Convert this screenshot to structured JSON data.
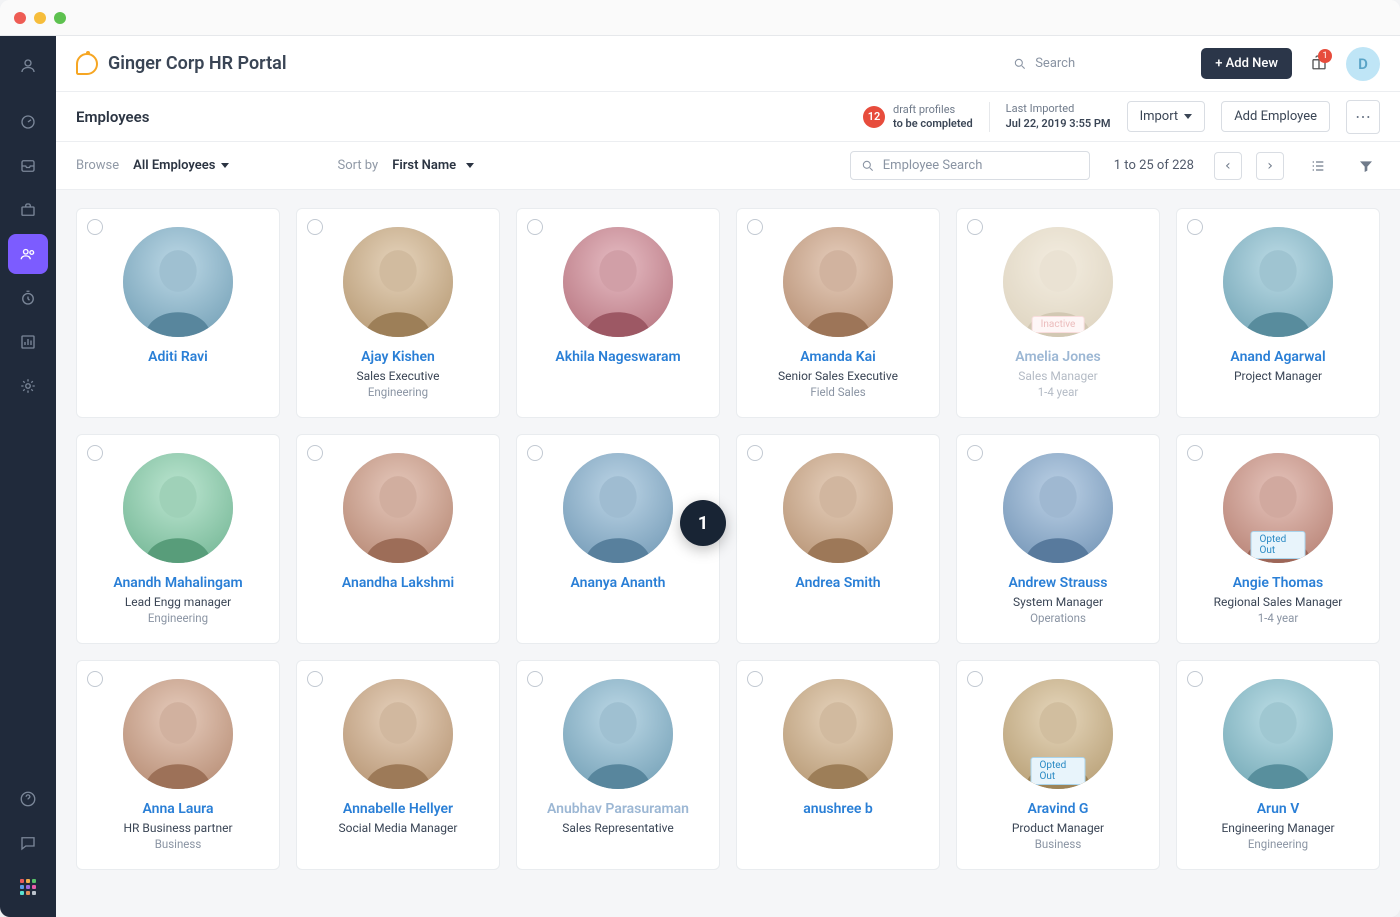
{
  "sidebar": {
    "items": [
      {
        "name": "profile",
        "active": false
      },
      {
        "name": "dashboard",
        "active": false
      },
      {
        "name": "inbox",
        "active": false
      },
      {
        "name": "briefcase",
        "active": false
      },
      {
        "name": "people",
        "active": true
      },
      {
        "name": "time",
        "active": false
      },
      {
        "name": "reports",
        "active": false
      },
      {
        "name": "settings",
        "active": false
      }
    ],
    "bottom": [
      {
        "name": "help"
      },
      {
        "name": "chat"
      },
      {
        "name": "apps"
      }
    ]
  },
  "topbar": {
    "brand": "Ginger Corp HR Portal",
    "search_placeholder": "Search",
    "add_new_label": "+ Add New",
    "gift_badge": "1",
    "avatar_letter": "D"
  },
  "pageheader": {
    "title": "Employees",
    "draft_count": "12",
    "draft_line1": "draft profiles",
    "draft_line2": "to be completed",
    "last_imported_label": "Last Imported",
    "last_imported_value": "Jul 22, 2019 3:55 PM",
    "import_label": "Import",
    "add_employee_label": "Add Employee"
  },
  "filters": {
    "browse_label": "Browse",
    "browse_value": "All Employees",
    "sort_label": "Sort by",
    "sort_value": "First Name",
    "employee_search_placeholder": "Employee Search",
    "pagination_info": "1 to 25 of 228"
  },
  "step_badge": "1",
  "employees": [
    {
      "name": "Aditi Ravi",
      "role": "",
      "dept": "",
      "status": null,
      "muted": false,
      "hue": 200
    },
    {
      "name": "Ajay Kishen",
      "role": "Sales Executive",
      "dept": "Engineering",
      "status": null,
      "muted": false,
      "hue": 34
    },
    {
      "name": "Akhila Nageswaram",
      "role": "",
      "dept": "",
      "status": null,
      "muted": false,
      "hue": 350
    },
    {
      "name": "Amanda Kai",
      "role": "Senior Sales Executive",
      "dept": "Field Sales",
      "status": null,
      "muted": false,
      "hue": 25
    },
    {
      "name": "Amelia Jones",
      "role": "Sales Manager",
      "dept": "1-4 year",
      "status": "Inactive",
      "muted": true,
      "hue": 40
    },
    {
      "name": "Anand Agarwal",
      "role": "Project Manager",
      "dept": "",
      "status": null,
      "muted": false,
      "hue": 195
    },
    {
      "name": "Anandh Mahalingam",
      "role": "Lead Engg manager",
      "dept": "Engineering",
      "status": null,
      "muted": false,
      "hue": 150
    },
    {
      "name": "Anandha Lakshmi",
      "role": "",
      "dept": "",
      "status": null,
      "muted": false,
      "hue": 18
    },
    {
      "name": "Ananya Ananth",
      "role": "",
      "dept": "",
      "status": null,
      "muted": false,
      "hue": 205
    },
    {
      "name": "Andrea Smith",
      "role": "",
      "dept": "",
      "status": null,
      "muted": false,
      "hue": 28
    },
    {
      "name": "Andrew Strauss",
      "role": "System Manager",
      "dept": "Operations",
      "status": null,
      "muted": false,
      "hue": 210
    },
    {
      "name": "Angie Thomas",
      "role": "Regional Sales Manager",
      "dept": "1-4 year",
      "status": "Opted Out",
      "muted": false,
      "hue": 12
    },
    {
      "name": "Anna Laura",
      "role": "HR Business partner",
      "dept": "Business",
      "status": null,
      "muted": false,
      "hue": 22
    },
    {
      "name": "Annabelle Hellyer",
      "role": "Social Media Manager",
      "dept": "",
      "status": null,
      "muted": false,
      "hue": 30
    },
    {
      "name": "Anubhav Parasuraman",
      "role": "Sales Representative",
      "dept": "",
      "status": null,
      "muted": true,
      "hue": 200
    },
    {
      "name": "anushree b",
      "role": "",
      "dept": "",
      "status": null,
      "muted": false,
      "hue": 33
    },
    {
      "name": "Aravind G",
      "role": "Product Manager",
      "dept": "Business",
      "status": "Opted Out",
      "muted": false,
      "hue": 38
    },
    {
      "name": "Arun V",
      "role": "Engineering Manager",
      "dept": "Engineering",
      "status": null,
      "muted": false,
      "hue": 192
    }
  ]
}
